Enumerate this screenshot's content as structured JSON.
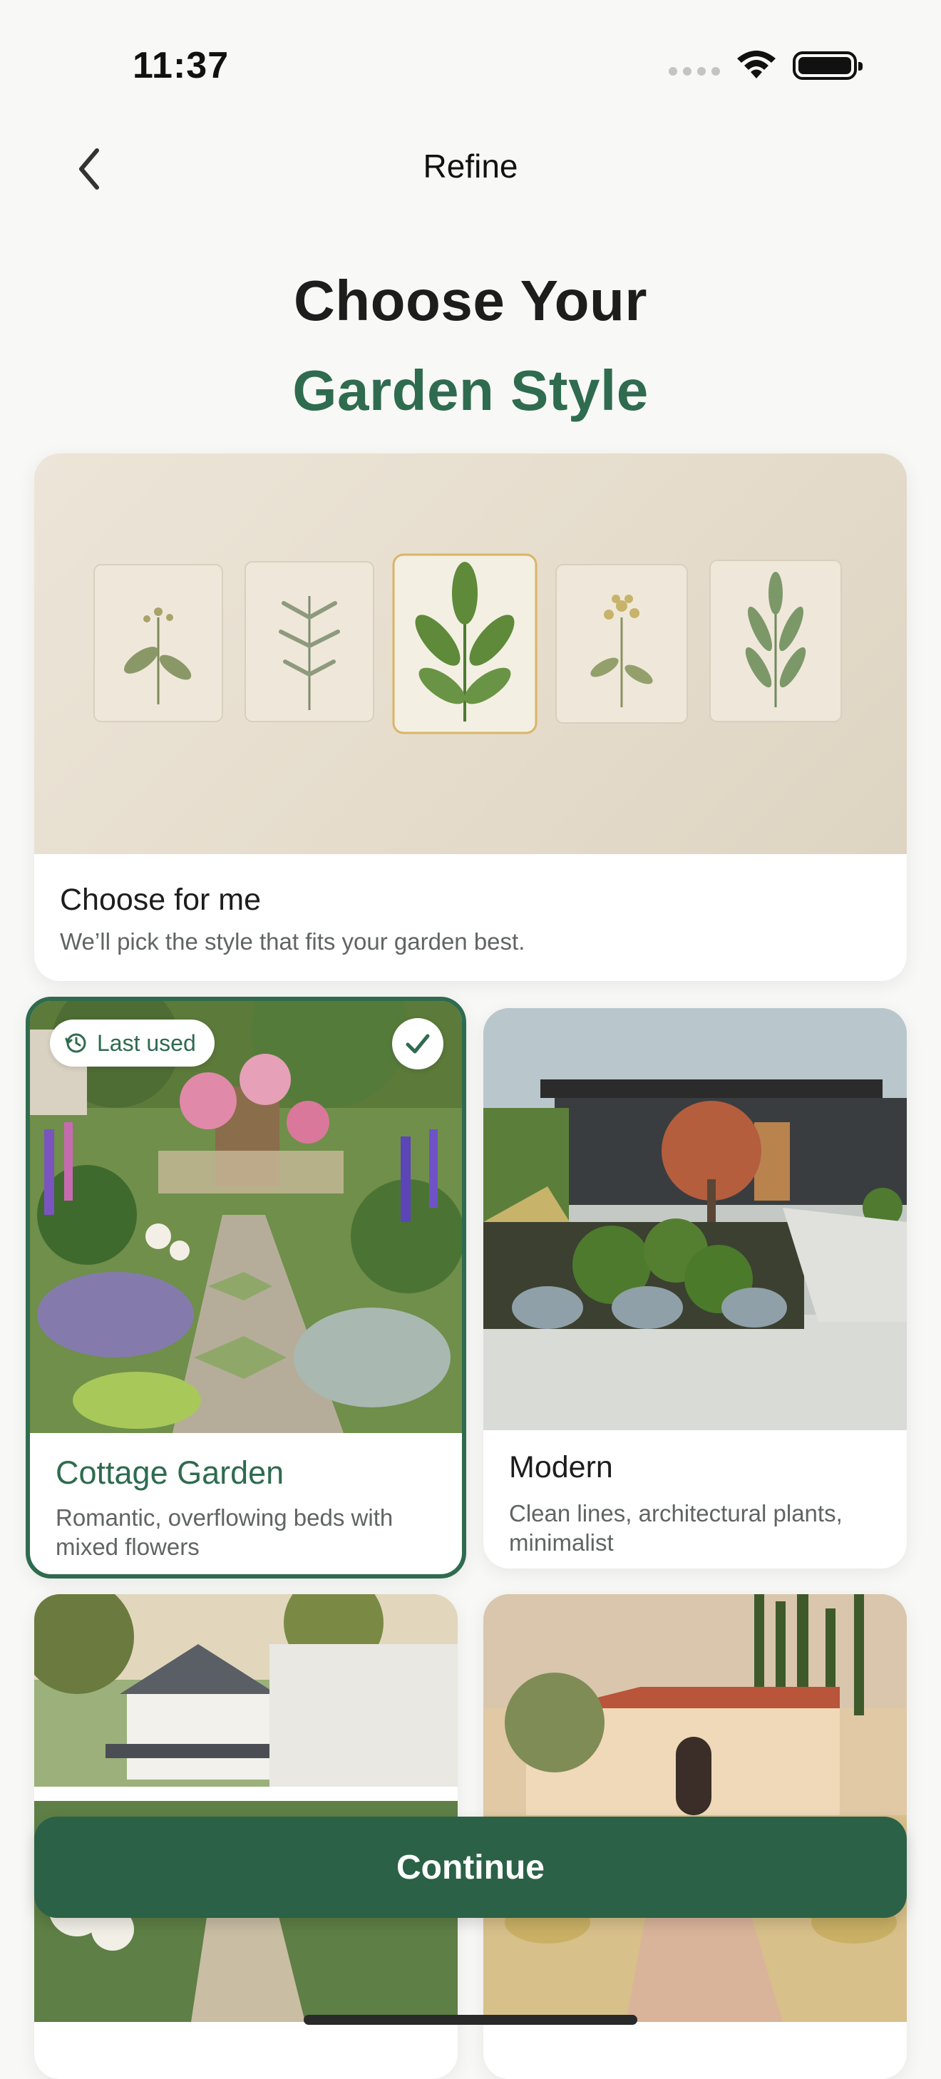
{
  "status_bar": {
    "time": "11:37",
    "wifi_icon": "wifi-icon",
    "battery_icon": "battery-icon"
  },
  "nav": {
    "title": "Refine",
    "back_icon": "chevron-left-icon"
  },
  "heading": {
    "line1": "Choose Your",
    "line2": "Garden Style"
  },
  "options": {
    "choose_for_me": {
      "label": "Choose for me",
      "description": "We’ll pick the style that fits your garden best."
    },
    "cottage": {
      "label": "Cottage Garden",
      "description": "Romantic, overflowing beds with mixed flowers",
      "badge": "Last used",
      "selected": true
    },
    "modern": {
      "label": "Modern",
      "description": "Clean lines, architectural plants, minimalist"
    }
  },
  "continue_button": {
    "label": "Continue"
  },
  "colors": {
    "accent": "#2f6b4f",
    "button": "#2b6146",
    "background": "#f8f8f6"
  }
}
